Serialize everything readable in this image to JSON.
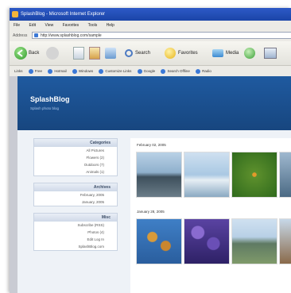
{
  "window": {
    "title": "SplashBlog - Microsoft Internet Explorer"
  },
  "menu": [
    "File",
    "Edit",
    "View",
    "Favorites",
    "Tools",
    "Help"
  ],
  "address": {
    "label": "Address",
    "url": "http://www.splashblog.com/sample"
  },
  "toolbar": {
    "back": "Back",
    "search": "Search",
    "favorites": "Favorites",
    "media": "Media"
  },
  "links": [
    "Links",
    "Free",
    "Hotmail",
    "Windows",
    "Customize Links",
    "Google",
    "Search Offline",
    "Radio"
  ],
  "blog": {
    "title": "SplashBlog",
    "tagline": "Splash photo blog"
  },
  "sidebar": {
    "categories": {
      "header": "Categories",
      "items": [
        "All Pictures",
        "Flowers (2)",
        "Outdoors (7)",
        "Animals (1)"
      ]
    },
    "archives": {
      "header": "Archives",
      "items": [
        "February, 2005",
        "January, 2005"
      ]
    },
    "more": {
      "header": "Misc",
      "items": [
        "Subscribe (RSS)",
        "Photos (4)",
        "Edit Log In",
        "SplashBlog.com"
      ]
    }
  },
  "main": {
    "dates": [
      "February 02, 2005",
      "January 28, 2005"
    ]
  },
  "colors": {
    "banner": "#1f5aa0",
    "title_bar": "#2d59c6"
  }
}
